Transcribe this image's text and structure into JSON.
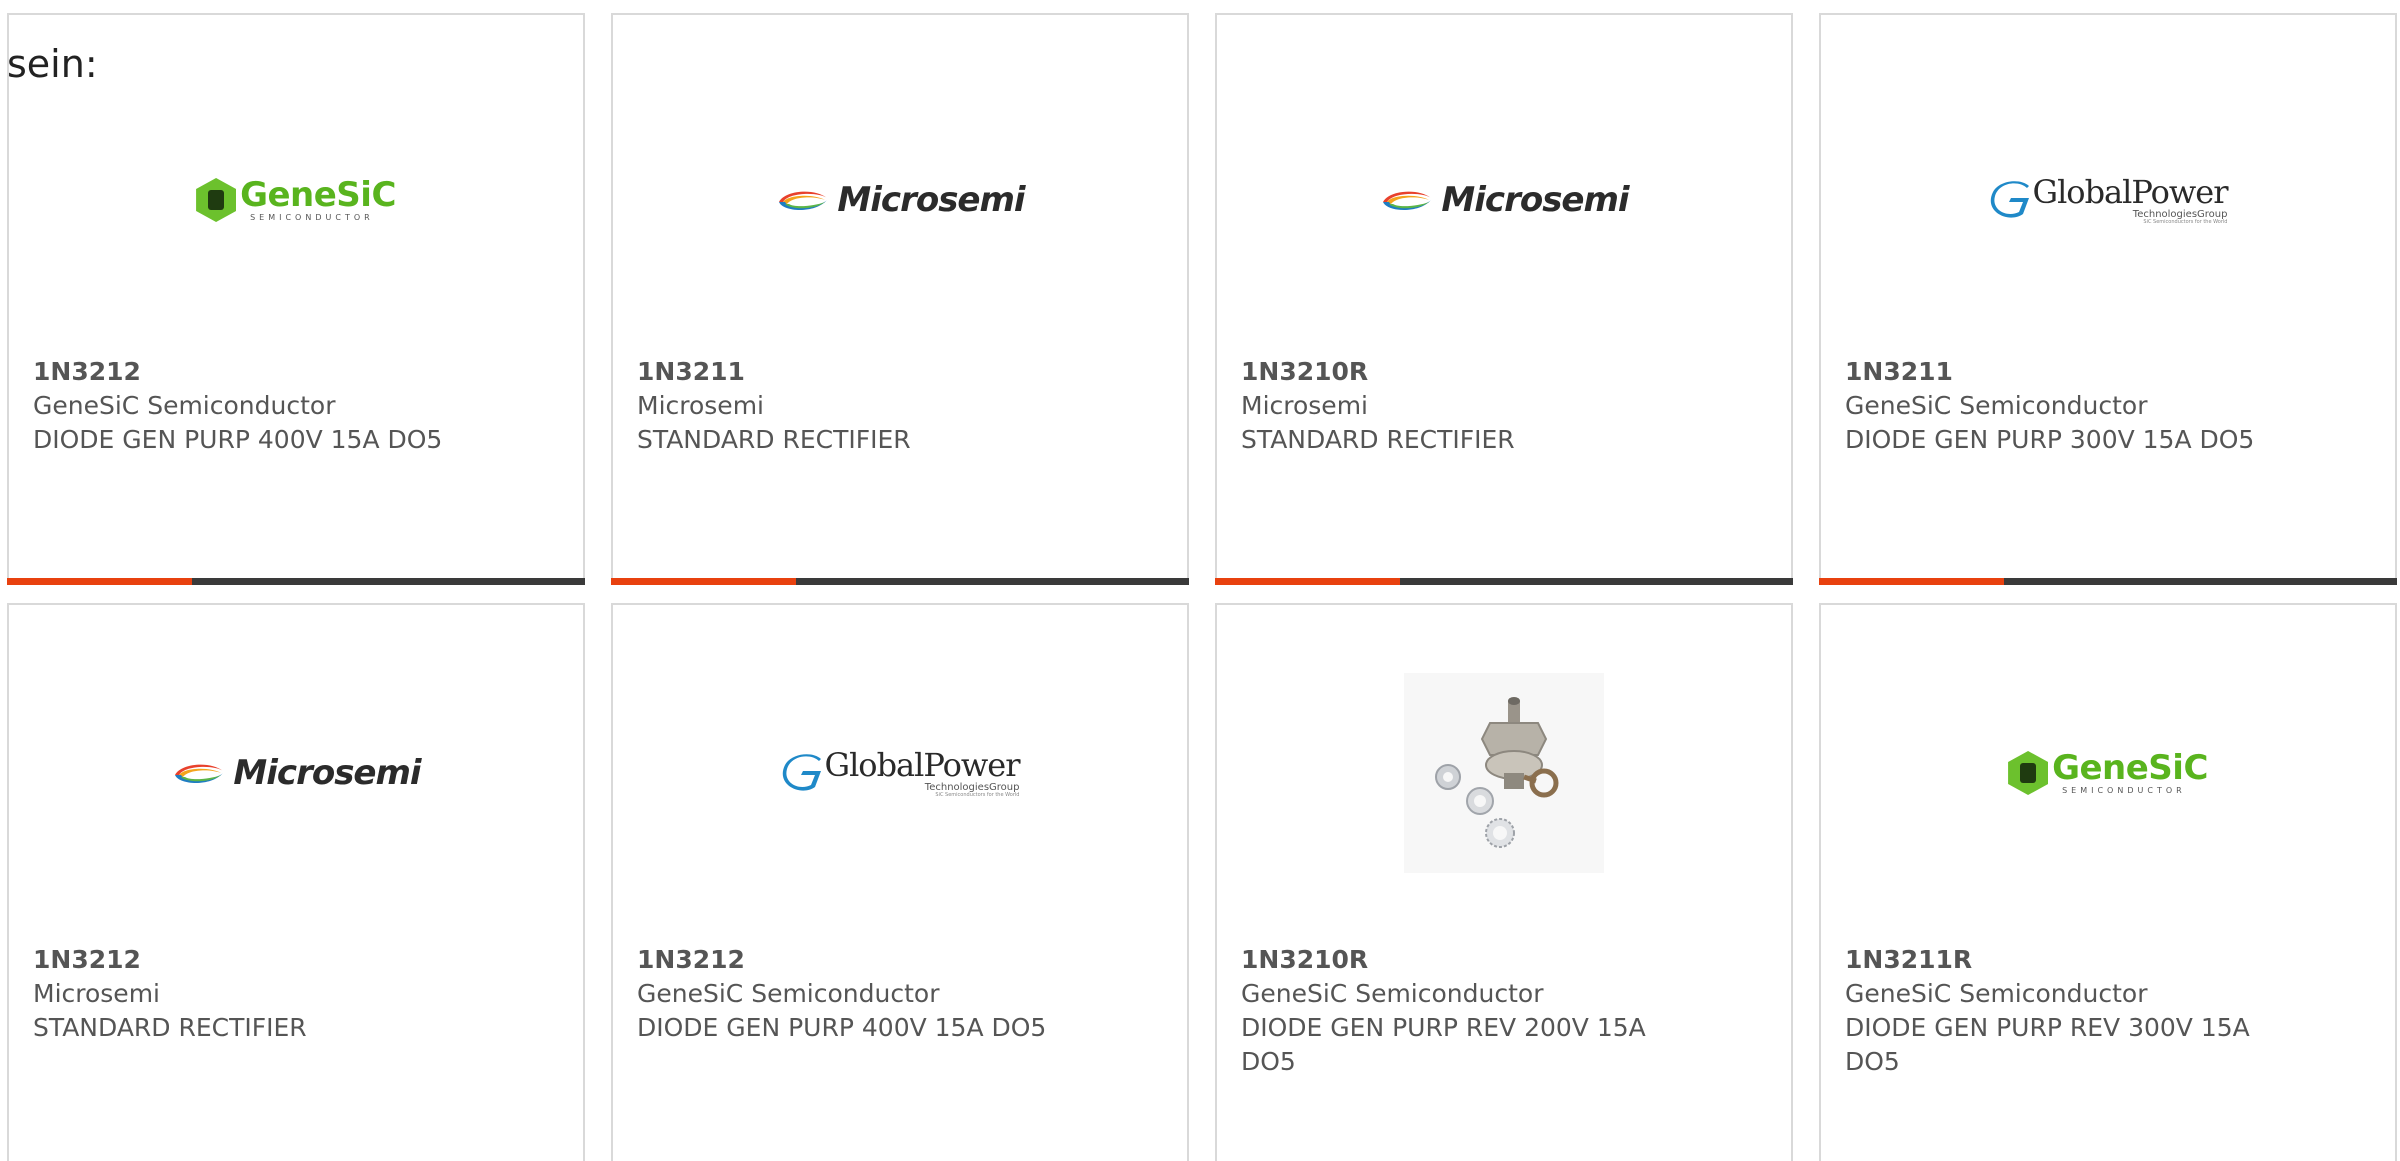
{
  "intro_text": "sein:",
  "colors": {
    "accent": "#e8410f",
    "bar_dark": "#3a3a3a",
    "text": "#555555",
    "border": "#d9d9d9"
  },
  "cards": [
    {
      "part": "1N3212",
      "manufacturer": "GeneSiC Semiconductor",
      "description": "DIODE GEN PURP 400V 15A DO5",
      "logo": "GeneSiC",
      "logo_sub": "SEMICONDUCTOR",
      "progress": 0.32
    },
    {
      "part": "1N3211",
      "manufacturer": "Microsemi",
      "description": "STANDARD RECTIFIER",
      "logo": "Microsemi",
      "progress": 0.32
    },
    {
      "part": "1N3210R",
      "manufacturer": "Microsemi",
      "description": "STANDARD RECTIFIER",
      "logo": "Microsemi",
      "progress": 0.32
    },
    {
      "part": "1N3211",
      "manufacturer": "GeneSiC Semiconductor",
      "description": "DIODE GEN PURP 300V 15A DO5",
      "logo": "GlobalPower",
      "logo_sub": "TechnologiesGroup",
      "logo_tiny": "SiC Semiconductors for the World",
      "progress": 0.32
    },
    {
      "part": "1N3212",
      "manufacturer": "Microsemi",
      "description": "STANDARD RECTIFIER",
      "logo": "Microsemi"
    },
    {
      "part": "1N3212",
      "manufacturer": "GeneSiC Semiconductor",
      "description": "DIODE GEN PURP 400V 15A DO5",
      "logo": "GlobalPower",
      "logo_sub": "TechnologiesGroup",
      "logo_tiny": "SiC Semiconductors for the World"
    },
    {
      "part": "1N3210R",
      "manufacturer": "GeneSiC Semiconductor",
      "description": "DIODE GEN PURP REV 200V 15A DO5",
      "logo": "product-photo-diode-stud"
    },
    {
      "part": "1N3211R",
      "manufacturer": "GeneSiC Semiconductor",
      "description": "DIODE GEN PURP REV 300V 15A DO5",
      "logo": "GeneSiC",
      "logo_sub": "SEMICONDUCTOR"
    }
  ]
}
